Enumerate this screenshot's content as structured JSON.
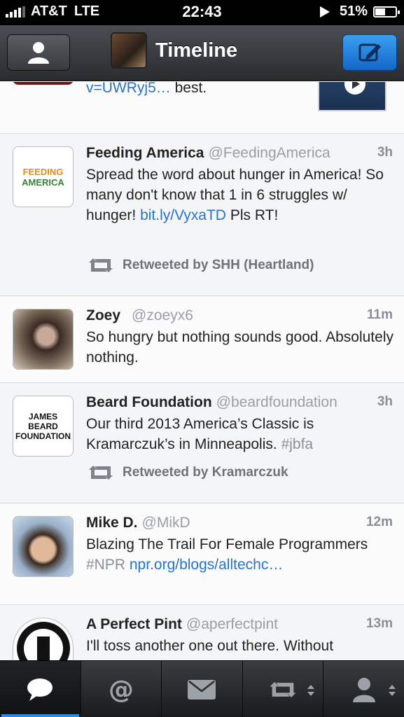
{
  "status_bar": {
    "carrier": "AT&T",
    "network": "LTE",
    "time": "22:43",
    "battery": "51%"
  },
  "nav": {
    "title": "Timeline",
    "left_icon": "person-icon",
    "right_icon": "compose-icon",
    "accent": "#1f7fe0"
  },
  "partial_tweet": {
    "text_link": "v=UWRyj5…",
    "text_tail": " best."
  },
  "tweets": [
    {
      "name": "Feeding America",
      "handle": "@FeedingAmerica",
      "time": "3h",
      "body_1": "Spread the word about hunger in America! So many don't know that 1 in 6 struggles w/ hunger! ",
      "link": "bit.ly/VyxaTD",
      "body_2": " Pls RT!",
      "retweeted_by": "Retweeted by SHH (Heartland)",
      "avatar_text_1": "FEEDING",
      "avatar_text_2": "AMERICA"
    },
    {
      "name": "Zoey",
      "handle": "@zoeyx6",
      "time": "11m",
      "body_1": "So hungry but nothing sounds good. Absolutely nothing."
    },
    {
      "name": "Beard Foundation",
      "handle": "@beardfoundation",
      "time": "3h",
      "body_1": "Our third 2013 America’s Classic is Kramarczuk’s in Minneapolis. ",
      "hashtag": "#jbfa",
      "retweeted_by": "Retweeted by Kramarczuk",
      "avatar_text_1": "JAMES",
      "avatar_text_2": "BEARD",
      "avatar_text_3": "FOUNDATION"
    },
    {
      "name": "Mike D.",
      "handle": "@MikD",
      "time": "12m",
      "body_1": "Blazing The Trail For Female Programmers ",
      "hashtag": "#NPR",
      "link": "npr.org/blogs/alltechc…"
    },
    {
      "name": "A Perfect Pint",
      "handle": "@aperfectpint",
      "time": "13m",
      "body_1": "I'll toss another one out there. Without"
    }
  ],
  "tabs": [
    {
      "name": "timeline",
      "icon": "speech-bubble-icon",
      "active": true
    },
    {
      "name": "mentions",
      "icon": "at-sign-icon"
    },
    {
      "name": "messages",
      "icon": "envelope-icon"
    },
    {
      "name": "retweets",
      "icon": "retweet-icon"
    },
    {
      "name": "profile",
      "icon": "person-icon"
    }
  ]
}
